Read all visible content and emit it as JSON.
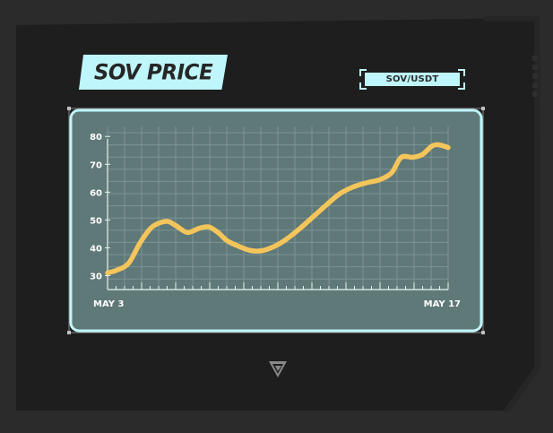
{
  "header": {
    "title": "SOV PRICE",
    "pair": "SOV/USDT"
  },
  "colors": {
    "background": "#2b2b2b",
    "frame": "#1e1e1e",
    "accent": "#bff6fb",
    "plot_fill": "#5f7878",
    "line": "#f4c55a"
  },
  "logo": {
    "icon": "sovryn-logo-icon"
  },
  "chart_data": {
    "type": "line",
    "title": "SOV PRICE",
    "xlabel": "",
    "ylabel": "",
    "x_start_label": "MAY 3",
    "x_end_label": "MAY 17",
    "y_ticks": [
      30,
      40,
      50,
      60,
      70,
      80
    ],
    "ylim": [
      25,
      82
    ],
    "grid": true,
    "series": [
      {
        "values": [
          [
            3.0,
            31
          ],
          [
            3.4,
            32
          ],
          [
            3.9,
            34.5
          ],
          [
            4.4,
            42
          ],
          [
            4.9,
            47.5
          ],
          [
            5.5,
            49.5
          ],
          [
            5.9,
            48
          ],
          [
            6.4,
            45.5
          ],
          [
            6.9,
            47
          ],
          [
            7.3,
            47.5
          ],
          [
            7.7,
            45.5
          ],
          [
            8.1,
            42.5
          ],
          [
            8.6,
            40.5
          ],
          [
            9.1,
            39
          ],
          [
            9.6,
            39
          ],
          [
            10.1,
            40.5
          ],
          [
            10.6,
            43
          ],
          [
            11.2,
            47
          ],
          [
            11.8,
            51.5
          ],
          [
            12.4,
            56
          ],
          [
            12.9,
            59.5
          ],
          [
            13.5,
            62
          ],
          [
            14.1,
            63.5
          ],
          [
            14.6,
            64.5
          ],
          [
            15.1,
            67
          ],
          [
            15.5,
            72.5
          ],
          [
            16.0,
            72.5
          ],
          [
            16.4,
            73.5
          ],
          [
            16.8,
            76.5
          ],
          [
            17.1,
            77
          ],
          [
            17.5,
            76
          ]
        ]
      }
    ]
  }
}
